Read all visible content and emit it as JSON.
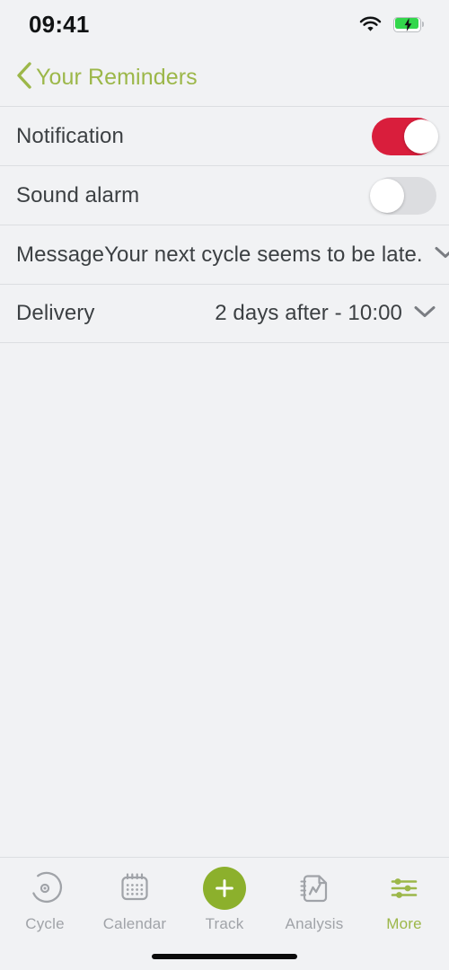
{
  "status_bar": {
    "time": "09:41",
    "wifi_icon": "wifi-icon",
    "battery_icon": "battery-charging-icon"
  },
  "nav": {
    "back_icon": "chevron-left-icon",
    "title": "Your Reminders",
    "accent_color": "#9cb749"
  },
  "settings": {
    "rows": [
      {
        "label": "Notification",
        "type": "toggle",
        "value": "on",
        "toggle_color": "#d91e3c"
      },
      {
        "label": "Sound alarm",
        "type": "toggle",
        "value": "off",
        "toggle_color": "#dcdde0"
      },
      {
        "label": "Message",
        "type": "select",
        "value": "Your next cycle seems to be late.",
        "icon": "chevron-down-icon"
      },
      {
        "label": "Delivery",
        "type": "select",
        "value": "2 days after - 10:00",
        "icon": "chevron-down-icon"
      }
    ]
  },
  "tabbar": {
    "active_color": "#9cb749",
    "inactive_color": "#a0a3a8",
    "track_button_color": "#8cb02c",
    "items": [
      {
        "label": "Cycle",
        "icon": "cycle-icon",
        "active": false
      },
      {
        "label": "Calendar",
        "icon": "calendar-icon",
        "active": false
      },
      {
        "label": "Track",
        "icon": "plus-icon",
        "active": false
      },
      {
        "label": "Analysis",
        "icon": "analysis-document-icon",
        "active": false
      },
      {
        "label": "More",
        "icon": "sliders-icon",
        "active": true
      }
    ]
  },
  "home_indicator": "home-indicator"
}
